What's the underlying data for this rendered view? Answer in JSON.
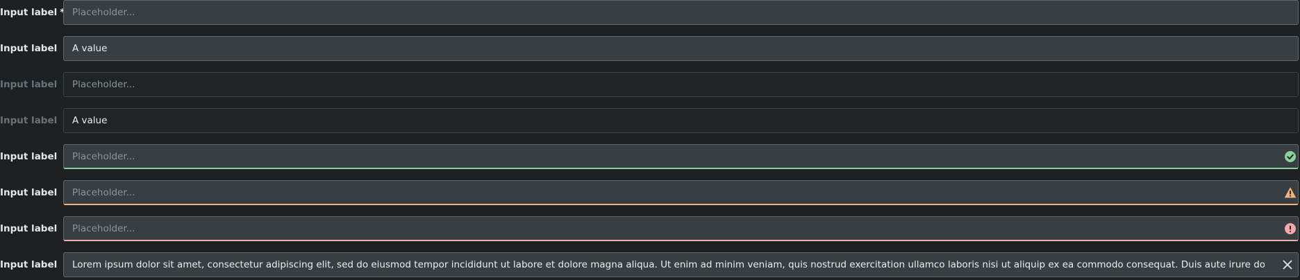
{
  "required_marker": "*",
  "rows": [
    {
      "label": "Input label",
      "placeholder": "Placeholder...",
      "value": "",
      "state": "required"
    },
    {
      "label": "Input label",
      "placeholder": "Placeholder...",
      "value": "A value",
      "state": "default"
    },
    {
      "label": "Input label",
      "placeholder": "Placeholder...",
      "value": "",
      "state": "disabled"
    },
    {
      "label": "Input label",
      "placeholder": "Placeholder...",
      "value": "A value",
      "state": "disabled"
    },
    {
      "label": "Input label",
      "placeholder": "Placeholder...",
      "value": "",
      "state": "success",
      "icon": "check-circle-icon"
    },
    {
      "label": "Input label",
      "placeholder": "Placeholder...",
      "value": "",
      "state": "warning",
      "icon": "warning-triangle-icon"
    },
    {
      "label": "Input label",
      "placeholder": "Placeholder...",
      "value": "",
      "state": "danger",
      "icon": "exclamation-circle-icon"
    },
    {
      "label": "Input label",
      "placeholder": "",
      "value": "Lorem ipsum dolor sit amet, consectetur adipiscing elit, sed do eiusmod tempor incididunt ut labore et dolore magna aliqua. Ut enim ad minim veniam, quis nostrud exercitation ullamco laboris nisi ut aliquip ex ea commodo consequat. Duis aute irure dolor in reprehenderit",
      "state": "textarea",
      "icon": "close-icon"
    }
  ],
  "colors": {
    "background": "#1e2123",
    "field_background": "#393e42",
    "disabled_background": "#202426",
    "success": "#8bd19b",
    "warning": "#f2b27c",
    "danger": "#f4a9ad"
  }
}
